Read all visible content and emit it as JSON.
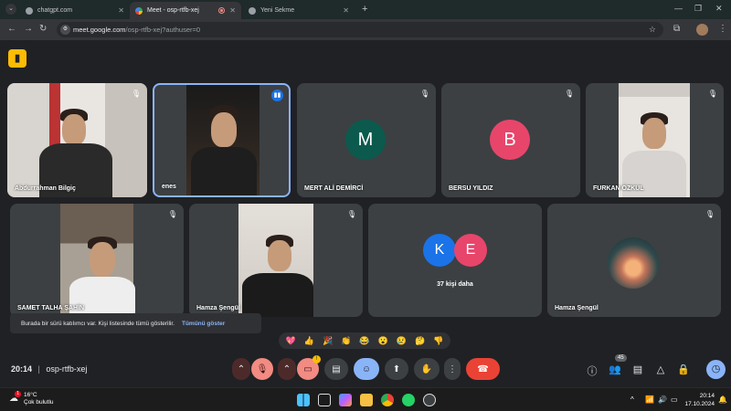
{
  "browser": {
    "tabs": [
      {
        "title": "chatgpt.com",
        "active": false
      },
      {
        "title": "Meet - osp-rtfb-xej",
        "active": true
      },
      {
        "title": "Yeni Sekme",
        "active": false
      }
    ],
    "new_tab": "+",
    "url_host": "meet.google.com",
    "url_path": "/osp-rtfb-xej?authuser=0"
  },
  "meet": {
    "participants_row1": [
      {
        "name": "Abdurrahman Bilgiç",
        "type": "video"
      },
      {
        "name": "enes",
        "type": "video",
        "speaking": true
      },
      {
        "name": "MERT ALİ DEMİRCİ",
        "type": "avatar",
        "initial": "M",
        "color": "#0b5a4d"
      },
      {
        "name": "BERSU YILDIZ",
        "type": "avatar",
        "initial": "B",
        "color": "#e8456b"
      },
      {
        "name": "FURKAN ÖZKUL",
        "type": "video"
      }
    ],
    "participants_row2": [
      {
        "name": "SAMET TALHA ŞAHİN",
        "type": "video"
      },
      {
        "name": "Hamza Şengül",
        "type": "video"
      },
      {
        "name": "",
        "type": "group",
        "initials": [
          "K",
          "E"
        ],
        "more": "37 kişi daha"
      },
      {
        "name": "Hamza Şengül",
        "type": "image"
      }
    ],
    "notice": {
      "text": "Burada bir sürü katılımcı var. Kişi listesinde tümü gösterilir.",
      "link": "Tümünü göster"
    },
    "reactions": [
      "💖",
      "👍",
      "🎉",
      "👏",
      "😂",
      "😮",
      "😢",
      "🤔",
      "👎"
    ],
    "time": "20:14",
    "separator": "|",
    "meeting_code": "osp-rtfb-xej",
    "people_count": "45",
    "colors": {
      "leave": "#ea4335",
      "accent": "#8ab4f8",
      "avatar_k": "#1a73e8",
      "avatar_e": "#e8456b"
    }
  },
  "taskbar": {
    "weather_temp": "16°C",
    "weather_desc": "Çok bulutlu",
    "weather_badge": "1",
    "clock_time": "20:14",
    "clock_date": "17.10.2024",
    "tray_chevron": "^"
  }
}
